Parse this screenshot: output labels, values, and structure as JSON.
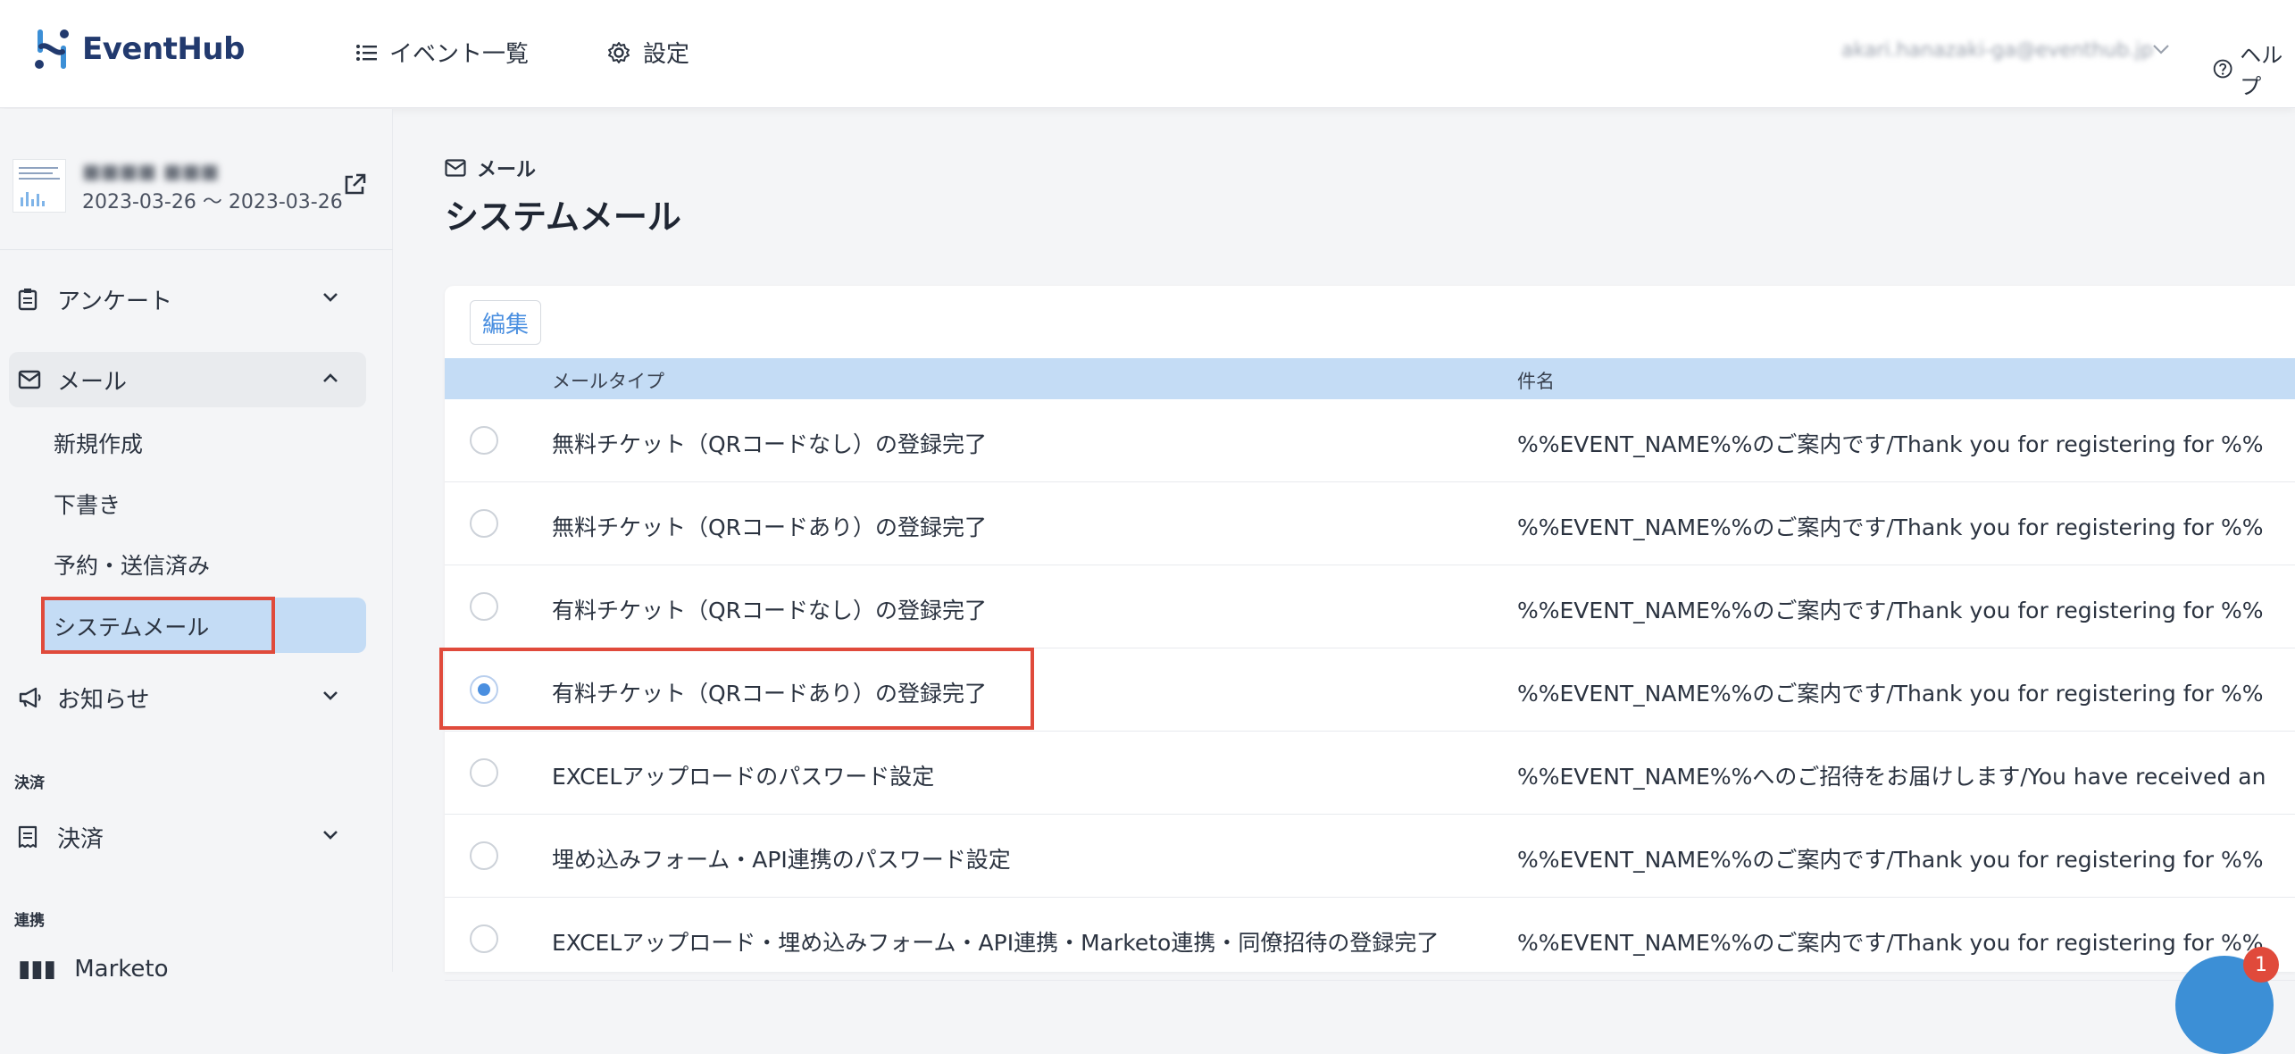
{
  "header": {
    "logo_text": "EventHub",
    "nav": [
      {
        "label": "イベント一覧",
        "icon": "list-icon"
      },
      {
        "label": "設定",
        "icon": "gear-icon"
      }
    ],
    "user_email": "akari.hanazaki-ga@eventhub.jp",
    "help_label": "ヘルプ"
  },
  "sidebar": {
    "event": {
      "name": "■■■■ ■■■",
      "dates": "2023-03-26 〜 2023-03-26"
    },
    "menu": {
      "survey": "アンケート",
      "mail": "メール",
      "mail_sub": [
        "新規作成",
        "下書き",
        "予約・送信済み",
        "システムメール"
      ],
      "news": "お知らせ",
      "payment_section": "決済",
      "payment": "決済",
      "link_section": "連携",
      "partial_item": "Marketo"
    }
  },
  "main": {
    "breadcrumb": "メール",
    "title": "システムメール",
    "edit_button": "編集",
    "columns": {
      "type": "メールタイプ",
      "subject": "件名"
    },
    "rows": [
      {
        "type": "無料チケット（QRコードなし）の登録完了",
        "subject": "%%EVENT_NAME%%のご案内です/Thank you for registering for %%",
        "checked": false
      },
      {
        "type": "無料チケット（QRコードあり）の登録完了",
        "subject": "%%EVENT_NAME%%のご案内です/Thank you for registering for %%",
        "checked": false
      },
      {
        "type": "有料チケット（QRコードなし）の登録完了",
        "subject": "%%EVENT_NAME%%のご案内です/Thank you for registering for %%",
        "checked": false
      },
      {
        "type": "有料チケット（QRコードあり）の登録完了",
        "subject": "%%EVENT_NAME%%のご案内です/Thank you for registering for %%",
        "checked": true
      },
      {
        "type": "EXCELアップロードのパスワード設定",
        "subject": "%%EVENT_NAME%%へのご招待をお届けします/You have received an",
        "checked": false
      },
      {
        "type": "埋め込みフォーム・API連携のパスワード設定",
        "subject": "%%EVENT_NAME%%のご案内です/Thank you for registering for %%",
        "checked": false
      },
      {
        "type": "EXCELアップロード・埋め込みフォーム・API連携・Marketo連携・同僚招待の登録完了",
        "subject": "%%EVENT_NAME%%のご案内です/Thank you for registering for %%",
        "checked": false
      }
    ]
  },
  "chat": {
    "badge_count": "1"
  },
  "colors": {
    "accent": "#4a8fe0",
    "table_header": "#c4dcf5",
    "highlight": "#e04a3b",
    "brand": "#223a6e"
  }
}
